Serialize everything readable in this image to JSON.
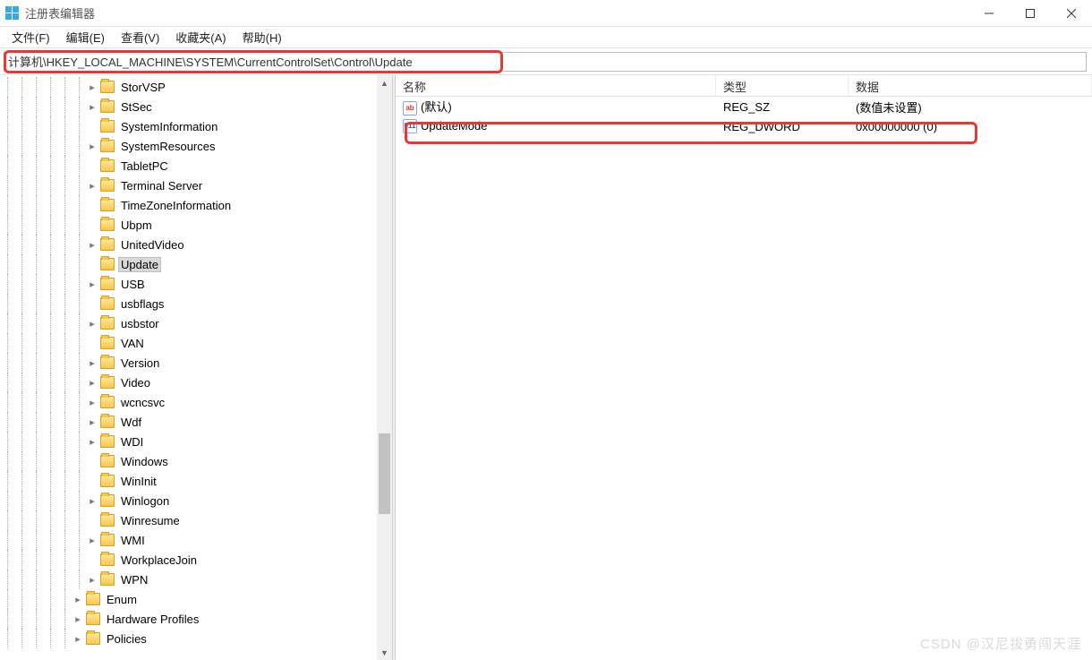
{
  "window": {
    "title": "注册表编辑器",
    "controls": {
      "min": "minimize",
      "max": "maximize",
      "close": "close"
    }
  },
  "menubar": {
    "items": [
      {
        "label": "文件(F)"
      },
      {
        "label": "编辑(E)"
      },
      {
        "label": "查看(V)"
      },
      {
        "label": "收藏夹(A)"
      },
      {
        "label": "帮助(H)"
      }
    ]
  },
  "addressbar": {
    "path": "计算机\\HKEY_LOCAL_MACHINE\\SYSTEM\\CurrentControlSet\\Control\\Update"
  },
  "tree": {
    "indent_unit": 16,
    "base_level": 6,
    "nodes": [
      {
        "label": "StorVSP",
        "level": 6,
        "expander": "closed"
      },
      {
        "label": "StSec",
        "level": 6,
        "expander": "closed"
      },
      {
        "label": "SystemInformation",
        "level": 6,
        "expander": "none"
      },
      {
        "label": "SystemResources",
        "level": 6,
        "expander": "closed"
      },
      {
        "label": "TabletPC",
        "level": 6,
        "expander": "none"
      },
      {
        "label": "Terminal Server",
        "level": 6,
        "expander": "closed"
      },
      {
        "label": "TimeZoneInformation",
        "level": 6,
        "expander": "none"
      },
      {
        "label": "Ubpm",
        "level": 6,
        "expander": "none"
      },
      {
        "label": "UnitedVideo",
        "level": 6,
        "expander": "closed"
      },
      {
        "label": "Update",
        "level": 6,
        "expander": "none",
        "selected": true
      },
      {
        "label": "USB",
        "level": 6,
        "expander": "closed"
      },
      {
        "label": "usbflags",
        "level": 6,
        "expander": "none"
      },
      {
        "label": "usbstor",
        "level": 6,
        "expander": "closed"
      },
      {
        "label": "VAN",
        "level": 6,
        "expander": "none"
      },
      {
        "label": "Version",
        "level": 6,
        "expander": "closed"
      },
      {
        "label": "Video",
        "level": 6,
        "expander": "closed"
      },
      {
        "label": "wcncsvc",
        "level": 6,
        "expander": "closed"
      },
      {
        "label": "Wdf",
        "level": 6,
        "expander": "closed"
      },
      {
        "label": "WDI",
        "level": 6,
        "expander": "closed"
      },
      {
        "label": "Windows",
        "level": 6,
        "expander": "none"
      },
      {
        "label": "WinInit",
        "level": 6,
        "expander": "none"
      },
      {
        "label": "Winlogon",
        "level": 6,
        "expander": "closed"
      },
      {
        "label": "Winresume",
        "level": 6,
        "expander": "none"
      },
      {
        "label": "WMI",
        "level": 6,
        "expander": "closed"
      },
      {
        "label": "WorkplaceJoin",
        "level": 6,
        "expander": "none"
      },
      {
        "label": "WPN",
        "level": 6,
        "expander": "closed"
      },
      {
        "label": "Enum",
        "level": 5,
        "expander": "closed"
      },
      {
        "label": "Hardware Profiles",
        "level": 5,
        "expander": "closed"
      },
      {
        "label": "Policies",
        "level": 5,
        "expander": "closed"
      }
    ]
  },
  "list": {
    "columns": {
      "name": "名称",
      "type": "类型",
      "data": "数据"
    },
    "rows": [
      {
        "icon": "sz",
        "name": "(默认)",
        "type": "REG_SZ",
        "data": "(数值未设置)"
      },
      {
        "icon": "dword",
        "name": "UpdateMode",
        "type": "REG_DWORD",
        "data": "0x00000000 (0)",
        "highlight": true
      }
    ]
  },
  "watermark": "CSDN @汉尼拔勇闯天涯"
}
